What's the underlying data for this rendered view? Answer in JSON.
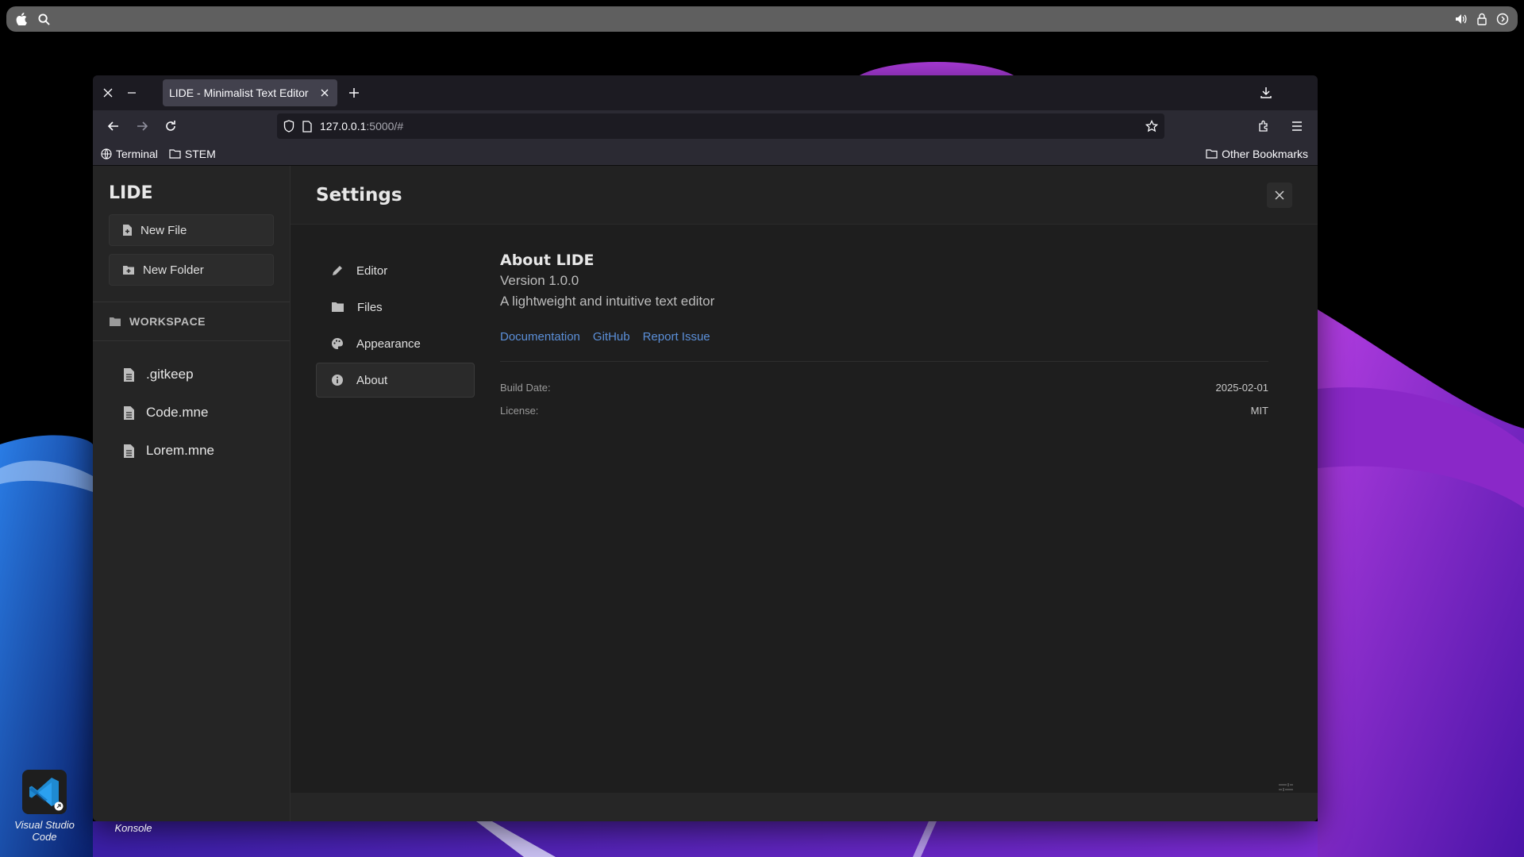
{
  "browser": {
    "tab_title": "LIDE - Minimalist Text Editor",
    "url_host": "127.0.0.1",
    "url_path": ":5000/#",
    "bookmarks": [
      "Terminal",
      "STEM"
    ],
    "other_bookmarks": "Other Bookmarks"
  },
  "sidebar": {
    "brand": "LIDE",
    "new_file": "New File",
    "new_folder": "New Folder",
    "workspace": "WORKSPACE",
    "files": [
      ".gitkeep",
      "Code.mne",
      "Lorem.mne"
    ]
  },
  "settings": {
    "title": "Settings",
    "nav": [
      "Editor",
      "Files",
      "Appearance",
      "About"
    ],
    "active_nav": "About"
  },
  "about": {
    "heading": "About LIDE",
    "version": "Version 1.0.0",
    "description": "A lightweight and intuitive text editor",
    "links": [
      "Documentation",
      "GitHub",
      "Report Issue"
    ],
    "build_date_label": "Build Date:",
    "build_date": "2025-02-01",
    "license_label": "License:",
    "license": "MIT"
  },
  "desktop": {
    "icons": [
      "Visual Studio Code",
      "Konsole"
    ]
  },
  "colors": {
    "accent_link": "#5b8fd8",
    "app_bg": "#1e1e1e",
    "sidebar_bg": "#252525",
    "browser_chrome": "#2b2a33"
  }
}
